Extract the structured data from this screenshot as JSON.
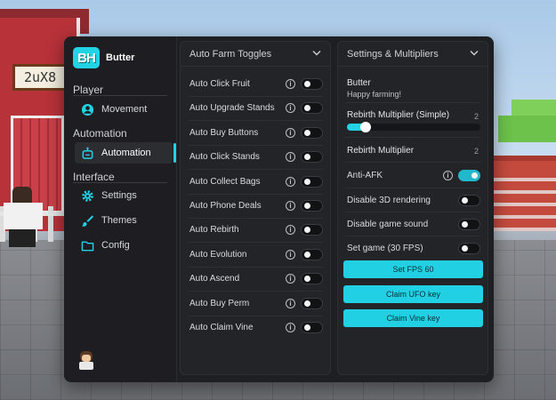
{
  "world": {
    "sign_text": "2uX8"
  },
  "app": {
    "logo_text": "BH",
    "name": "Butter"
  },
  "sidebar": {
    "sections": [
      {
        "label": "Player",
        "items": [
          {
            "label": "Movement",
            "icon": "user-circle-icon"
          }
        ]
      },
      {
        "label": "Automation",
        "items": [
          {
            "label": "Automation",
            "icon": "robot-icon",
            "active": true
          }
        ]
      },
      {
        "label": "Interface",
        "items": [
          {
            "label": "Settings",
            "icon": "gear-icon"
          },
          {
            "label": "Themes",
            "icon": "brush-icon"
          },
          {
            "label": "Config",
            "icon": "folder-icon"
          }
        ]
      }
    ],
    "accent_color": "#22d3e6"
  },
  "left_panel": {
    "title": "Auto Farm Toggles",
    "toggles": [
      {
        "label": "Auto Click Fruit",
        "on": false
      },
      {
        "label": "Auto Upgrade Stands",
        "on": false
      },
      {
        "label": "Auto Buy Buttons",
        "on": false
      },
      {
        "label": "Auto Click Stands",
        "on": false
      },
      {
        "label": "Auto Collect Bags",
        "on": false
      },
      {
        "label": "Auto Phone Deals",
        "on": false
      },
      {
        "label": "Auto Rebirth",
        "on": false
      },
      {
        "label": "Auto Evolution",
        "on": false
      },
      {
        "label": "Auto Ascend",
        "on": false
      },
      {
        "label": "Auto Buy Perm",
        "on": false
      },
      {
        "label": "Auto Claim Vine",
        "on": false
      }
    ]
  },
  "right_panel": {
    "title": "Settings & Multipliers",
    "paragraph": {
      "title": "Butter",
      "content": "Happy farming!"
    },
    "slider": {
      "label": "Rebirth Multiplier (Simple)",
      "value": "2",
      "fraction": 0.1
    },
    "input": {
      "label": "Rebirth Multiplier",
      "value": "2"
    },
    "anti_afk": {
      "label": "Anti-AFK",
      "on": true
    },
    "disable_3d": {
      "label": "Disable 3D rendering",
      "on": false
    },
    "disable_sound": {
      "label": "Disable game sound",
      "on": false
    },
    "set_game": {
      "label": "Set game (30 FPS)",
      "on": false
    },
    "buttons": [
      "Set FPS 60",
      "Claim UFO key",
      "Claim Vine key"
    ]
  }
}
